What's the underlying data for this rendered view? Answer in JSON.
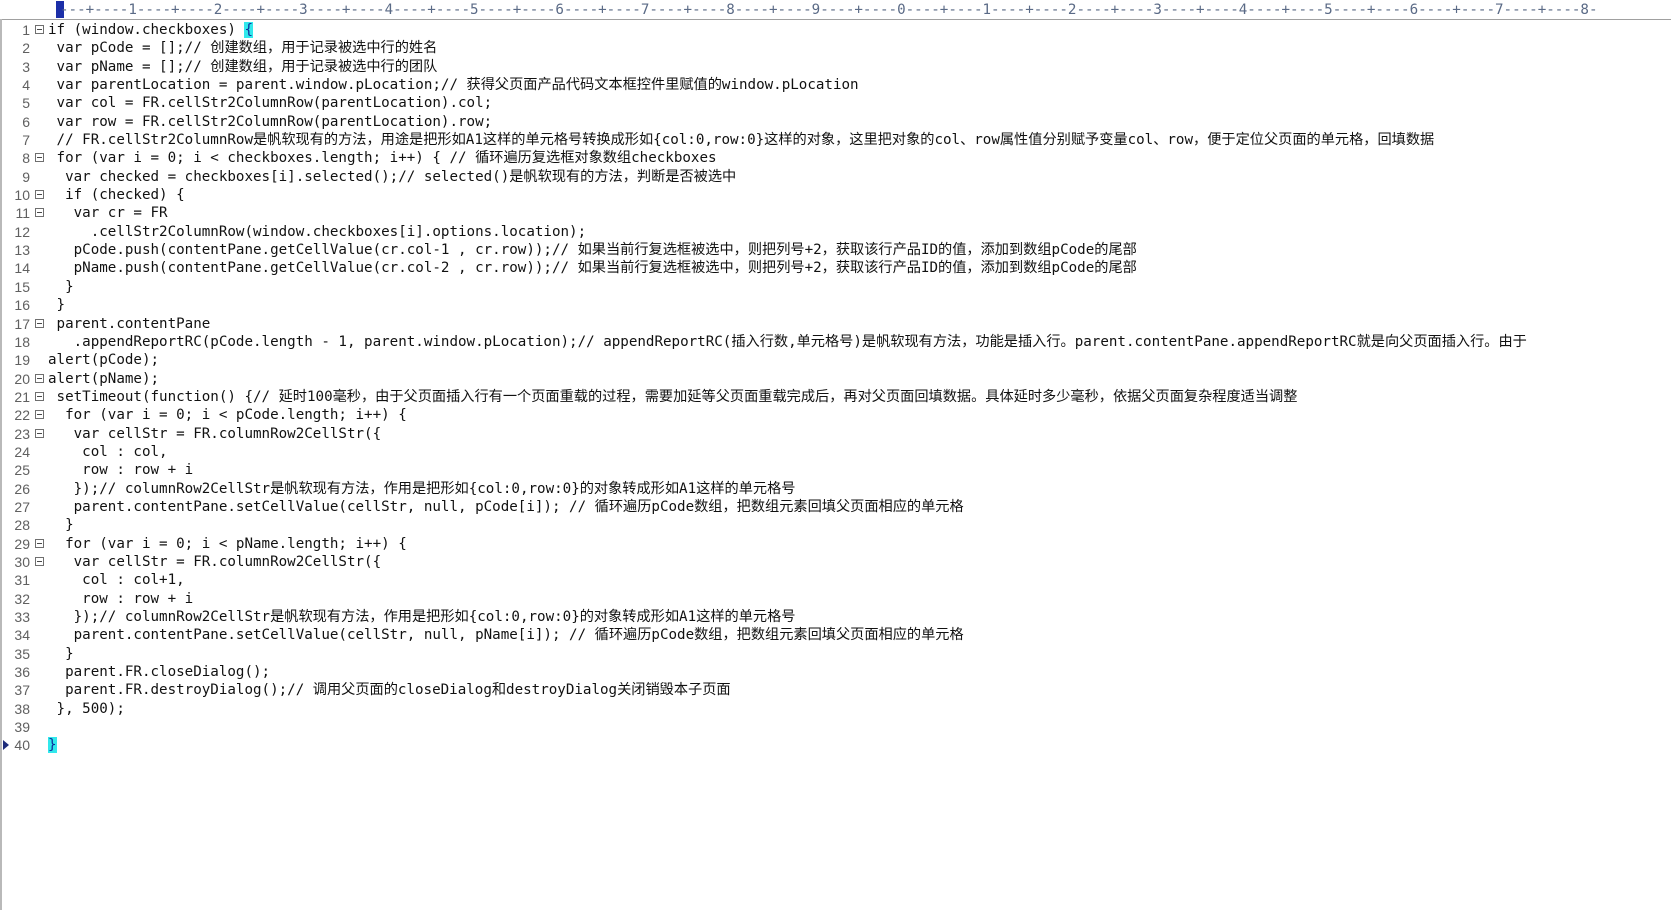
{
  "ruler": {
    "text": "---+----1----+----2----+----3----+----4----+----5----+----6----+----7----+----8----+----9----+----0----+----1----+----2----+----3----+----4----+----5----+----6----+----7----+----8-"
  },
  "editor": {
    "current_line": 40,
    "lines": [
      {
        "num": "1",
        "fold": true,
        "text": "if (window.checkboxes) ",
        "hl": "{"
      },
      {
        "num": "2",
        "fold": false,
        "text": " var pCode = [];// 创建数组，用于记录被选中行的姓名"
      },
      {
        "num": "3",
        "fold": false,
        "text": " var pName = [];// 创建数组，用于记录被选中行的团队"
      },
      {
        "num": "4",
        "fold": false,
        "text": " var parentLocation = parent.window.pLocation;// 获得父页面产品代码文本框控件里赋值的window.pLocation"
      },
      {
        "num": "5",
        "fold": false,
        "text": " var col = FR.cellStr2ColumnRow(parentLocation).col;"
      },
      {
        "num": "6",
        "fold": false,
        "text": " var row = FR.cellStr2ColumnRow(parentLocation).row;"
      },
      {
        "num": "7",
        "fold": false,
        "text": " // FR.cellStr2ColumnRow是帆软现有的方法，用途是把形如A1这样的单元格号转换成形如{col:0,row:0}这样的对象，这里把对象的col、row属性值分别赋予变量col、row，便于定位父页面的单元格，回填数据"
      },
      {
        "num": "8",
        "fold": true,
        "text": " for (var i = 0; i < checkboxes.length; i++) { // 循环遍历复选框对象数组checkboxes"
      },
      {
        "num": "9",
        "fold": false,
        "text": "  var checked = checkboxes[i].selected();// selected()是帆软现有的方法，判断是否被选中"
      },
      {
        "num": "10",
        "fold": true,
        "text": "  if (checked) {"
      },
      {
        "num": "11",
        "fold": true,
        "text": "   var cr = FR"
      },
      {
        "num": "12",
        "fold": false,
        "text": "     .cellStr2ColumnRow(window.checkboxes[i].options.location);"
      },
      {
        "num": "13",
        "fold": false,
        "text": "   pCode.push(contentPane.getCellValue(cr.col-1 , cr.row));// 如果当前行复选框被选中，则把列号+2，获取该行产品ID的值，添加到数组pCode的尾部"
      },
      {
        "num": "14",
        "fold": false,
        "text": "   pName.push(contentPane.getCellValue(cr.col-2 , cr.row));// 如果当前行复选框被选中，则把列号+2，获取该行产品ID的值，添加到数组pCode的尾部"
      },
      {
        "num": "15",
        "fold": false,
        "text": "  }"
      },
      {
        "num": "16",
        "fold": false,
        "text": " }"
      },
      {
        "num": "17",
        "fold": true,
        "text": " parent.contentPane"
      },
      {
        "num": "18",
        "fold": false,
        "text": "   .appendReportRC(pCode.length - 1, parent.window.pLocation);// appendReportRC(插入行数,单元格号)是帆软现有方法，功能是插入行。parent.contentPane.appendReportRC就是向父页面插入行。由于"
      },
      {
        "num": "19",
        "fold": false,
        "text": "alert(pCode);"
      },
      {
        "num": "20",
        "fold": true,
        "text": "alert(pName);"
      },
      {
        "num": "21",
        "fold": true,
        "text": " setTimeout(function() {// 延时100毫秒，由于父页面插入行有一个页面重载的过程，需要加延等父页面重载完成后，再对父页面回填数据。具体延时多少毫秒，依据父页面复杂程度适当调整"
      },
      {
        "num": "22",
        "fold": true,
        "text": "  for (var i = 0; i < pCode.length; i++) {"
      },
      {
        "num": "23",
        "fold": true,
        "text": "   var cellStr = FR.columnRow2CellStr({"
      },
      {
        "num": "24",
        "fold": false,
        "text": "    col : col,"
      },
      {
        "num": "25",
        "fold": false,
        "text": "    row : row + i"
      },
      {
        "num": "26",
        "fold": false,
        "text": "   });// columnRow2CellStr是帆软现有方法，作用是把形如{col:0,row:0}的对象转成形如A1这样的单元格号"
      },
      {
        "num": "27",
        "fold": false,
        "text": "   parent.contentPane.setCellValue(cellStr, null, pCode[i]); // 循环遍历pCode数组，把数组元素回填父页面相应的单元格"
      },
      {
        "num": "28",
        "fold": false,
        "text": "  }"
      },
      {
        "num": "29",
        "fold": true,
        "text": "  for (var i = 0; i < pName.length; i++) {"
      },
      {
        "num": "30",
        "fold": true,
        "text": "   var cellStr = FR.columnRow2CellStr({"
      },
      {
        "num": "31",
        "fold": false,
        "text": "    col : col+1,"
      },
      {
        "num": "32",
        "fold": false,
        "text": "    row : row + i"
      },
      {
        "num": "33",
        "fold": false,
        "text": "   });// columnRow2CellStr是帆软现有方法，作用是把形如{col:0,row:0}的对象转成形如A1这样的单元格号"
      },
      {
        "num": "34",
        "fold": false,
        "text": "   parent.contentPane.setCellValue(cellStr, null, pName[i]); // 循环遍历pCode数组，把数组元素回填父页面相应的单元格"
      },
      {
        "num": "35",
        "fold": false,
        "text": "  }"
      },
      {
        "num": "36",
        "fold": false,
        "text": "  parent.FR.closeDialog();"
      },
      {
        "num": "37",
        "fold": false,
        "text": "  parent.FR.destroyDialog();// 调用父页面的closeDialog和destroyDialog关闭销毁本子页面"
      },
      {
        "num": "38",
        "fold": false,
        "text": " }, 500);"
      },
      {
        "num": "39",
        "fold": false,
        "text": ""
      },
      {
        "num": "40",
        "fold": false,
        "text": "",
        "hl": "}"
      }
    ]
  }
}
